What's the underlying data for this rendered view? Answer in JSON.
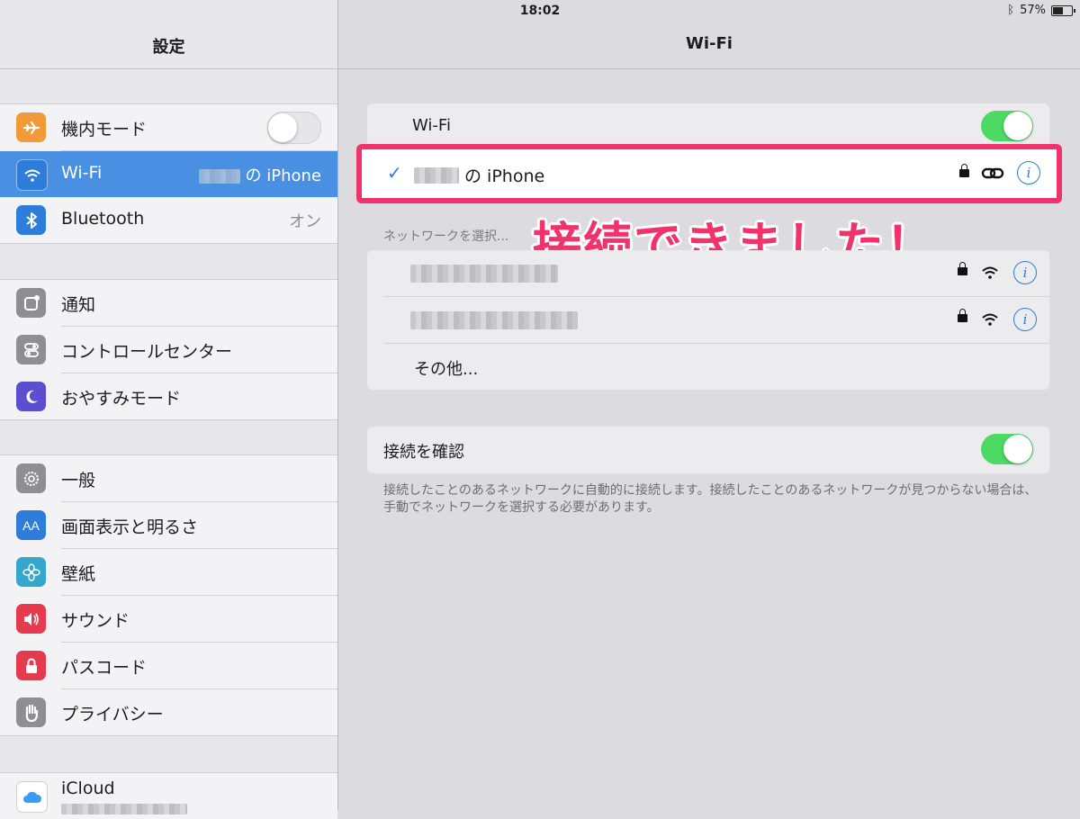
{
  "status": {
    "device": "iPad",
    "time": "18:02",
    "battery": "57%",
    "battery_fraction": 0.57
  },
  "sidebar": {
    "title": "設定",
    "group1": [
      {
        "label": "機内モード",
        "icon": "airplane-icon",
        "color": "#f19a37",
        "toggle": "off"
      },
      {
        "label": "Wi-Fi",
        "icon": "wifi-icon",
        "color": "#2f7ddb",
        "value_suffix": "の iPhone",
        "selected": true
      },
      {
        "label": "Bluetooth",
        "icon": "bluetooth-icon",
        "color": "#2f7ddb",
        "value": "オン"
      }
    ],
    "group2": [
      {
        "label": "通知",
        "icon": "notifications-icon",
        "color": "#8e8e93"
      },
      {
        "label": "コントロールセンター",
        "icon": "control-center-icon",
        "color": "#8e8e93"
      },
      {
        "label": "おやすみモード",
        "icon": "moon-icon",
        "color": "#5b4fcf"
      }
    ],
    "group3": [
      {
        "label": "一般",
        "icon": "gear-icon",
        "color": "#8e8e93"
      },
      {
        "label": "画面表示と明るさ",
        "icon": "display-icon",
        "color": "#2f7ddb",
        "glyph": "AA"
      },
      {
        "label": "壁紙",
        "icon": "wallpaper-icon",
        "color": "#35a6cc"
      },
      {
        "label": "サウンド",
        "icon": "sound-icon",
        "color": "#e63b4e"
      },
      {
        "label": "パスコード",
        "icon": "lock-icon",
        "color": "#e63b4e"
      },
      {
        "label": "プライバシー",
        "icon": "hand-icon",
        "color": "#8e8e93"
      }
    ],
    "group4": [
      {
        "label": "iCloud",
        "icon": "icloud-icon",
        "color": "#ffffff"
      }
    ]
  },
  "wifi": {
    "title": "Wi-Fi",
    "toggle_label": "Wi-Fi",
    "toggle": "on",
    "connected_suffix": "の iPhone",
    "annotation": "接続できました！",
    "section_caption": "ネットワークを選択...",
    "other_label": "その他...",
    "ask_label": "接続を確認",
    "ask_toggle": "on",
    "footer": "接続したことのあるネットワークに自動的に接続します。接続したことのあるネットワークが見つからない場合は、手動でネットワークを選択する必要があります。"
  },
  "colors": {
    "accent": "#2a7de1",
    "highlight": "#f0336b",
    "toggle_on": "#4cd964",
    "selected_row": "#4a90e2"
  }
}
